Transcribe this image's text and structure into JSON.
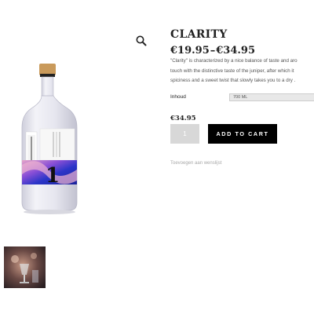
{
  "gallery": {
    "zoom_icon": "magnifier-icon",
    "bottle_label_number": "1"
  },
  "product": {
    "title": "CLARITY",
    "price_min": "€19.95",
    "price_separator": "–",
    "price_max": "€34.95",
    "description_lines": [
      "\"Clarity\" is characterized by a nice balance of taste and aro",
      "touch with the distinctive taste of the juniper, after which it",
      "spiciness and a sweet twist that slowly takes you to a dry ."
    ],
    "variation_label": "Inhoud",
    "variation_selected": "700 ML",
    "selected_price": "€34.95",
    "quantity": "1",
    "add_to_cart_label": "ADD TO CART",
    "wishlist_label": "Toevoegen aan wenslijst"
  },
  "colors": {
    "button": "#000000",
    "quantity_box": "#d8d8d8",
    "bottle_band": "#2b35c8"
  }
}
